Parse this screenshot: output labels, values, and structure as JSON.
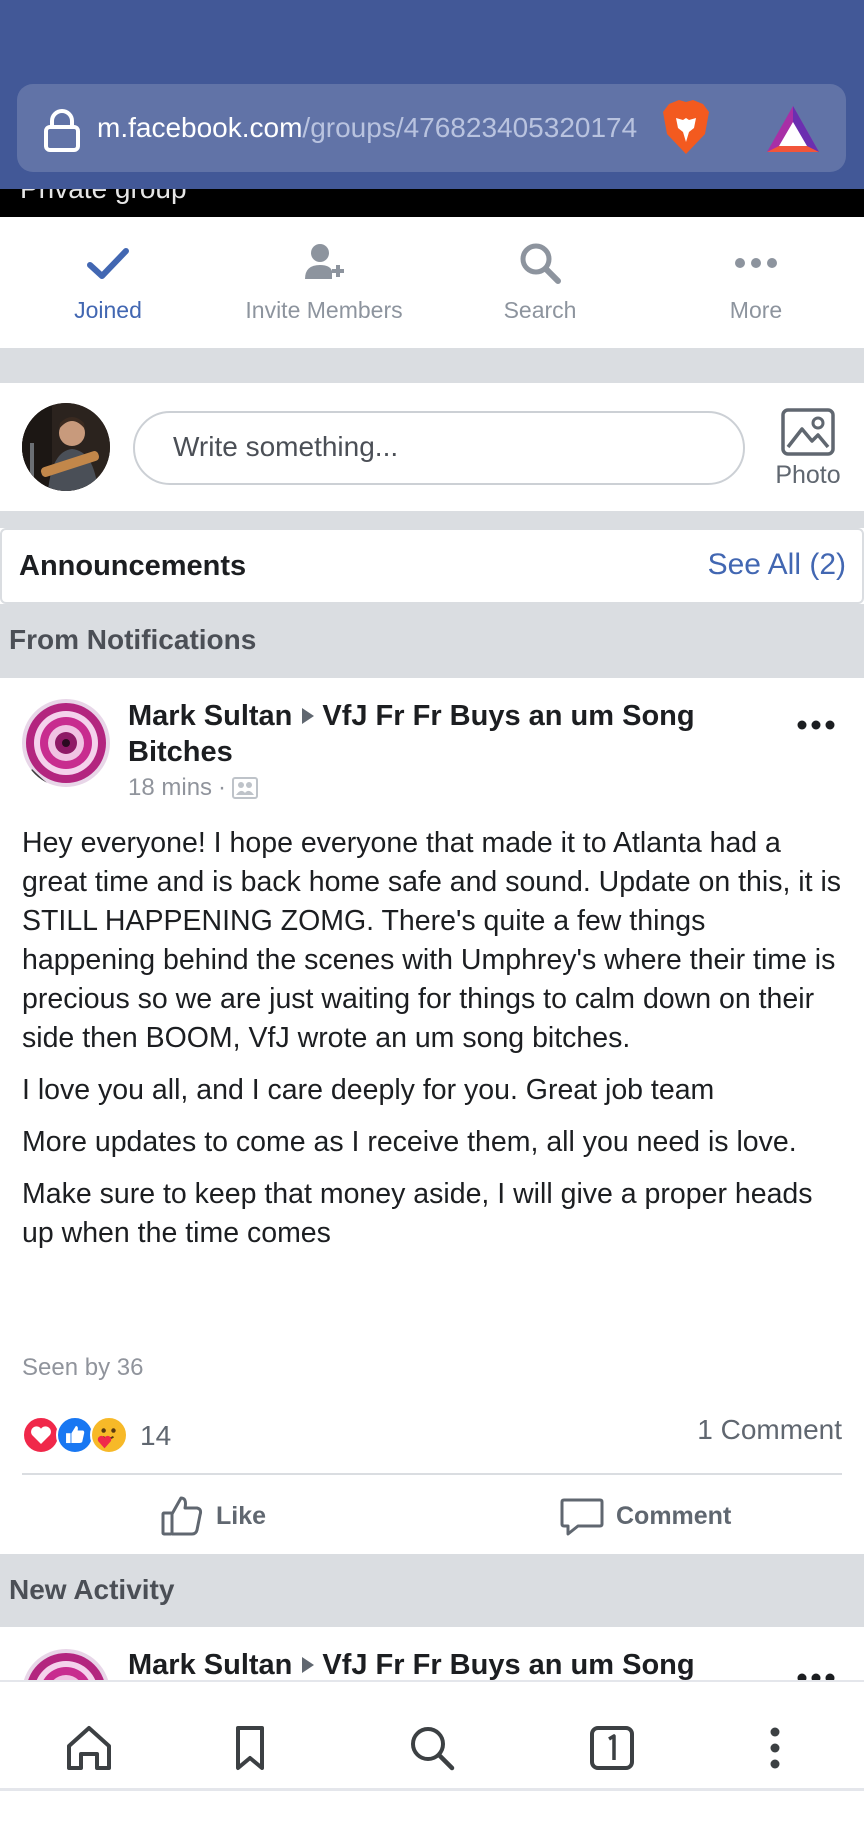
{
  "browser": {
    "url_host": "m.facebook.com",
    "url_path": "/groups/476823405320174",
    "strip_text": "Private group"
  },
  "group_tabs": [
    {
      "label": "Joined",
      "icon": "checkmark-icon",
      "active": true
    },
    {
      "label": "Invite Members",
      "icon": "add-person-icon",
      "active": false
    },
    {
      "label": "Search",
      "icon": "search-icon",
      "active": false
    },
    {
      "label": "More",
      "icon": "more-dots-icon",
      "active": false
    }
  ],
  "composer": {
    "placeholder": "Write something...",
    "photo_label": "Photo"
  },
  "announcements": {
    "title": "Announcements",
    "see_all": "See All (2)"
  },
  "sections": {
    "from_notifications": "From Notifications",
    "new_activity": "New Activity"
  },
  "post": {
    "author": "Mark Sultan",
    "group": "VfJ Fr Fr Buys an um Song Bitches",
    "time": "18 mins",
    "paragraphs": [
      "Hey everyone! I hope everyone that made it to Atlanta had a great time and is back home safe and sound. Update on this, it is STILL HAPPENING ZOMG. There's quite a few things happening behind the scenes with Umphrey's where their time is precious so we are just waiting for things to calm down on their side then BOOM, VfJ wrote an um song bitches.",
      "I love you all, and I care deeply for you. Great job team",
      "More updates to come as I receive them, all you need is love.",
      "Make sure to keep that money aside, I will give a proper heads up when the time comes"
    ],
    "seen_by": "Seen by 36",
    "reaction_count": "14",
    "comment_count": "1 Comment",
    "like_label": "Like",
    "comment_label": "Comment"
  },
  "post2": {
    "author": "Mark Sultan",
    "group": "VfJ Fr Fr Buys an um Song"
  },
  "colors": {
    "brand_blue": "#4267b2",
    "browser_bar": "#425897",
    "url_field": "#6173a7",
    "gap_gray": "#dadde1"
  }
}
